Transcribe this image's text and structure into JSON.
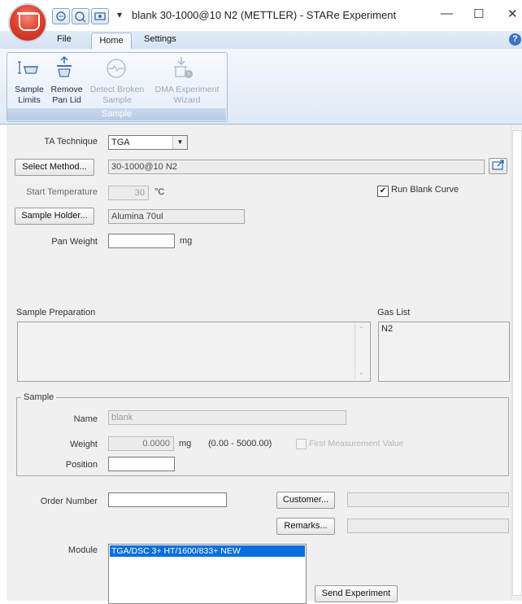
{
  "window": {
    "title": "blank 30-1000@10 N2 (METTLER) - STARe Experiment",
    "qat_dropdown": "▾",
    "minimize": "—",
    "maximize": "☐",
    "close": "✕"
  },
  "ribbon": {
    "tabs": {
      "file": "File",
      "home": "Home",
      "settings": "Settings"
    },
    "help": "?",
    "group_label": "Sample",
    "buttons": {
      "sample_limits": {
        "line1": "Sample",
        "line2": "Limits"
      },
      "remove_pan_lid": {
        "line1": "Remove",
        "line2": "Pan Lid"
      },
      "detect_broken": {
        "line1": "Detect Broken",
        "line2": "Sample"
      },
      "dma_wizard": {
        "line1": "DMA Experiment",
        "line2": "Wizard"
      }
    }
  },
  "form": {
    "ta_technique": {
      "label": "TA Technique",
      "value": "TGA",
      "dropdown": "▼"
    },
    "select_method": {
      "button": "Select Method...",
      "value": "30-1000@10 N2"
    },
    "start_temperature": {
      "label": "Start Temperature",
      "value": "30",
      "unit": "°C"
    },
    "run_blank_curve": {
      "label": "Run Blank Curve",
      "checked": true,
      "mark": "✔"
    },
    "sample_holder": {
      "button": "Sample Holder...",
      "value": "Alumina 70ul"
    },
    "pan_weight": {
      "label": "Pan Weight",
      "value": "",
      "unit": "mg"
    },
    "sample_preparation": {
      "label": "Sample Preparation",
      "value": ""
    },
    "gas_list": {
      "label": "Gas List",
      "items": [
        "N2"
      ]
    },
    "sample_group": {
      "label": "Sample",
      "name": {
        "label": "Name",
        "value": "blank"
      },
      "weight": {
        "label": "Weight",
        "value": "0.0000",
        "unit": "mg",
        "range": "(0.00 - 5000.00)"
      },
      "first_measurement": {
        "label": "First Measurement Value",
        "checked": false
      },
      "position": {
        "label": "Position",
        "value": ""
      }
    },
    "order_number": {
      "label": "Order Number",
      "value": ""
    },
    "customer": {
      "button": "Customer...",
      "value": ""
    },
    "remarks": {
      "button": "Remarks...",
      "value": ""
    },
    "module": {
      "label": "Module",
      "items": [
        "TGA/DSC 3+ HT/1600/833+ NEW"
      ],
      "selected_index": 0
    },
    "send_experiment": {
      "button": "Send Experiment"
    }
  },
  "colors": {
    "selection": "#0a6fdc",
    "ribbon_blue": "#dfe9f6",
    "orb_red": "#e0432f"
  }
}
